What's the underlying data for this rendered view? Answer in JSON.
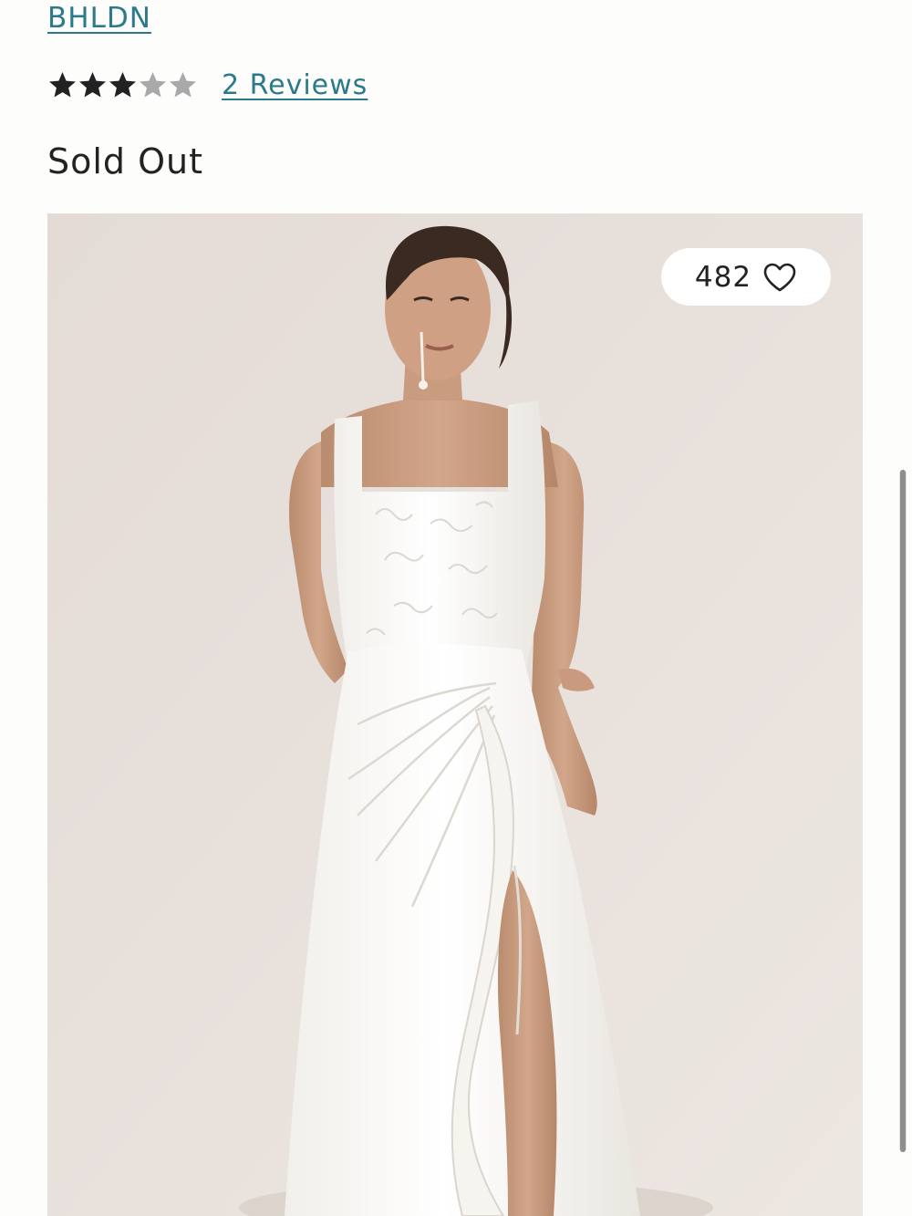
{
  "product": {
    "brand": "BHLDN",
    "rating": 3,
    "rating_max": 5,
    "reviews_label": "2 Reviews",
    "availability": "Sold Out"
  },
  "gallery": {
    "like_count": "482",
    "like_icon": "heart-outline-icon",
    "scroll_position": 0.5
  },
  "colors": {
    "link": "#2b7a8c",
    "star_filled": "#222222",
    "star_empty": "#a9a9a9",
    "photo_background": "#e8dfda"
  }
}
